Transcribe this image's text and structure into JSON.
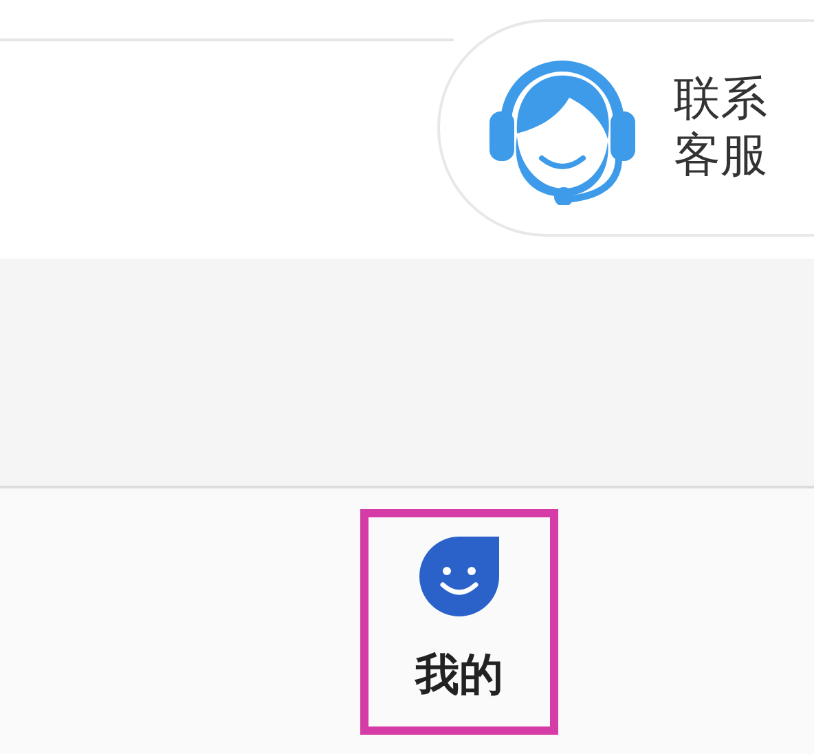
{
  "support_button": {
    "label": "联系客服"
  },
  "tab_bar": {
    "items": [
      {
        "label": "我的",
        "highlighted": true
      }
    ]
  }
}
